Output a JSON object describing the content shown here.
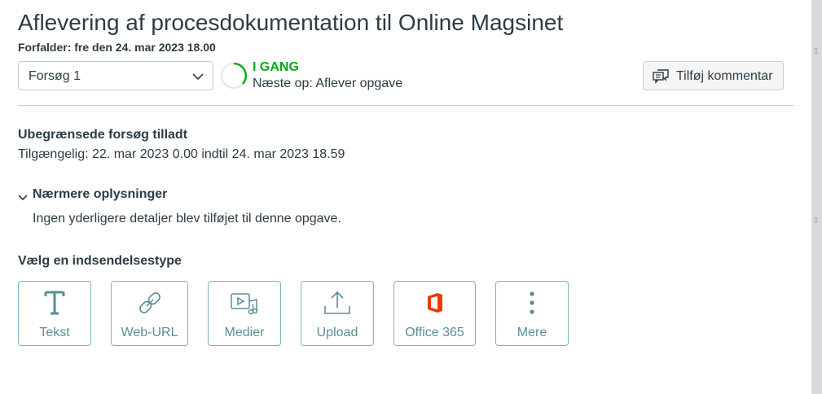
{
  "assignment": {
    "title": "Aflevering af procesdokumentation til Online Magsinet",
    "due": "Forfalder: fre den 24. mar 2023 18.00"
  },
  "attempt": {
    "selected": "Forsøg 1"
  },
  "status": {
    "label": "I GANG",
    "next_step": "Næste op: Aflever opgave",
    "color": "#00ac18"
  },
  "comment_button": {
    "label": "Tilføj kommentar"
  },
  "info": {
    "attempts": "Ubegrænsede forsøg tilladt",
    "available": "Tilgængelig: 22. mar 2023 0.00 indtil 24. mar 2023 18.59"
  },
  "details": {
    "toggle_label": "Nærmere oplysninger",
    "text": "Ingen yderligere detaljer blev tilføjet til denne opgave."
  },
  "submission": {
    "heading": "Vælg en indsendelsestype",
    "types": [
      {
        "label": "Tekst",
        "icon": "text-icon"
      },
      {
        "label": "Web-URL",
        "icon": "link-icon"
      },
      {
        "label": "Medier",
        "icon": "media-icon"
      },
      {
        "label": "Upload",
        "icon": "upload-icon"
      },
      {
        "label": "Office 365",
        "icon": "office365-icon"
      },
      {
        "label": "Mere",
        "icon": "more-icon"
      }
    ]
  },
  "colors": {
    "accent": "#5a8d96",
    "border": "#7ab5be",
    "text": "#2d3b45",
    "office_red": "#eb3c00"
  }
}
